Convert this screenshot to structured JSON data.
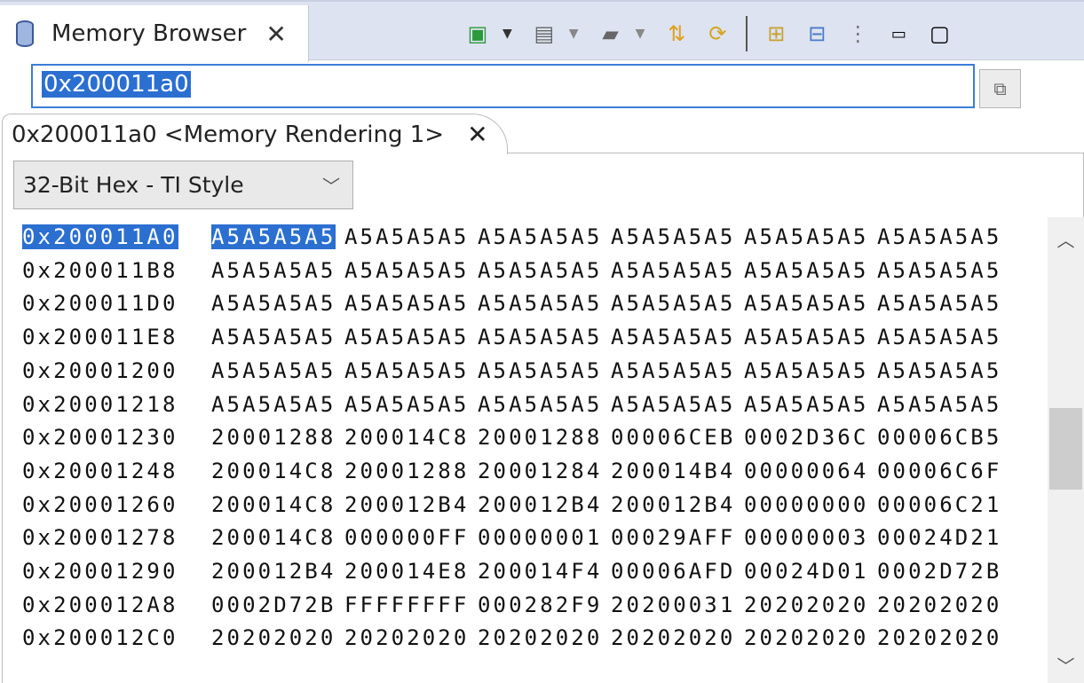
{
  "view_tab": {
    "title": "Memory Browser",
    "icon": "database-icon"
  },
  "toolbar": {
    "icons": [
      "new-connection-icon",
      "memory-file-icon",
      "memory-chip-icon",
      "import-export-icon",
      "refresh-icon",
      "new-tab-icon",
      "pin-icon",
      "view-menu-icon",
      "minimize-icon",
      "maximize-icon"
    ]
  },
  "address_input": {
    "value": "0x200011a0"
  },
  "rendering_tab": {
    "title": "0x200011a0 <Memory Rendering 1>"
  },
  "format_select": {
    "value": "32-Bit Hex - TI Style"
  },
  "memory": {
    "selected_address": "0x200011A0",
    "rows": [
      {
        "address": "0x200011A0",
        "values": [
          "A5A5A5A5",
          "A5A5A5A5",
          "A5A5A5A5",
          "A5A5A5A5",
          "A5A5A5A5",
          "A5A5A5A5"
        ]
      },
      {
        "address": "0x200011B8",
        "values": [
          "A5A5A5A5",
          "A5A5A5A5",
          "A5A5A5A5",
          "A5A5A5A5",
          "A5A5A5A5",
          "A5A5A5A5"
        ]
      },
      {
        "address": "0x200011D0",
        "values": [
          "A5A5A5A5",
          "A5A5A5A5",
          "A5A5A5A5",
          "A5A5A5A5",
          "A5A5A5A5",
          "A5A5A5A5"
        ]
      },
      {
        "address": "0x200011E8",
        "values": [
          "A5A5A5A5",
          "A5A5A5A5",
          "A5A5A5A5",
          "A5A5A5A5",
          "A5A5A5A5",
          "A5A5A5A5"
        ]
      },
      {
        "address": "0x20001200",
        "values": [
          "A5A5A5A5",
          "A5A5A5A5",
          "A5A5A5A5",
          "A5A5A5A5",
          "A5A5A5A5",
          "A5A5A5A5"
        ]
      },
      {
        "address": "0x20001218",
        "values": [
          "A5A5A5A5",
          "A5A5A5A5",
          "A5A5A5A5",
          "A5A5A5A5",
          "A5A5A5A5",
          "A5A5A5A5"
        ]
      },
      {
        "address": "0x20001230",
        "values": [
          "20001288",
          "200014C8",
          "20001288",
          "00006CEB",
          "0002D36C",
          "00006CB5"
        ]
      },
      {
        "address": "0x20001248",
        "values": [
          "200014C8",
          "20001288",
          "20001284",
          "200014B4",
          "00000064",
          "00006C6F"
        ]
      },
      {
        "address": "0x20001260",
        "values": [
          "200014C8",
          "200012B4",
          "200012B4",
          "200012B4",
          "00000000",
          "00006C21"
        ]
      },
      {
        "address": "0x20001278",
        "values": [
          "200014C8",
          "000000FF",
          "00000001",
          "00029AFF",
          "00000003",
          "00024D21"
        ]
      },
      {
        "address": "0x20001290",
        "values": [
          "200012B4",
          "200014E8",
          "200014F4",
          "00006AFD",
          "00024D01",
          "0002D72B"
        ]
      },
      {
        "address": "0x200012A8",
        "values": [
          "0002D72B",
          "FFFFFFFF",
          "000282F9",
          "20200031",
          "20202020",
          "20202020"
        ]
      },
      {
        "address": "0x200012C0",
        "values": [
          "20202020",
          "20202020",
          "20202020",
          "20202020",
          "20202020",
          "20202020"
        ]
      }
    ]
  },
  "colors": {
    "selection": "#2b6fd1",
    "toolbar_bg": "#dde3f0"
  }
}
